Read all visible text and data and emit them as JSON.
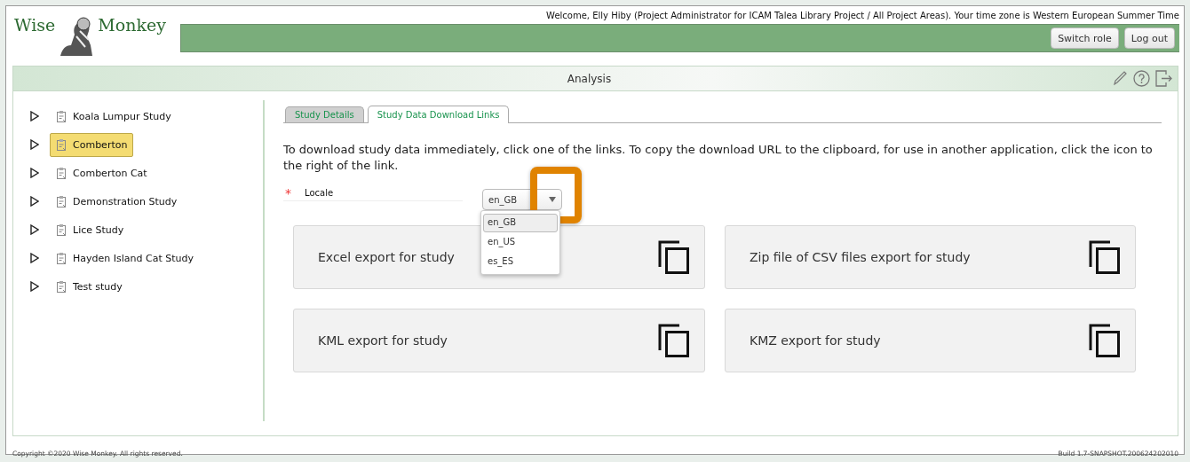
{
  "header": {
    "brand_left": "Wise",
    "brand_right": "Monkey",
    "welcome": "Welcome, Elly Hiby (Project Administrator for ICAM Talea Library Project / All Project Areas). Your time zone is Western European Summer Time",
    "buttons": [
      "Switch role",
      "Log out"
    ]
  },
  "panel": {
    "title": "Analysis"
  },
  "studies": [
    {
      "label": "Koala Lumpur Study",
      "selected": false
    },
    {
      "label": "Comberton",
      "selected": true
    },
    {
      "label": "Comberton Cat",
      "selected": false
    },
    {
      "label": "Demonstration Study",
      "selected": false
    },
    {
      "label": "Lice Study",
      "selected": false
    },
    {
      "label": "Hayden Island Cat Study",
      "selected": false
    },
    {
      "label": "Test study",
      "selected": false
    }
  ],
  "tabs": [
    {
      "label": "Study Details",
      "selected": false
    },
    {
      "label": "Study Data Download Links",
      "selected": true
    }
  ],
  "intro": "To download study data immediately, click one of the links. To copy the download URL to the clipboard, for use in another application, click the icon to the right of the link.",
  "locale": {
    "label": "Locale",
    "required_mark": "*",
    "value": "en_GB",
    "expanded": true,
    "options": [
      {
        "label": "en_GB",
        "selected": true
      },
      {
        "label": "en_US",
        "selected": false
      },
      {
        "label": "es_ES",
        "selected": false
      }
    ]
  },
  "exports": [
    "Excel export for study",
    "Zip file of CSV files export for study",
    "KML export for study",
    "KMZ export for study"
  ],
  "footer": {
    "copyright": "Copyright ©2020 Wise Monkey. All rights reserved.",
    "build": "Build 1.7-SNAPSHOT.200624202010"
  }
}
